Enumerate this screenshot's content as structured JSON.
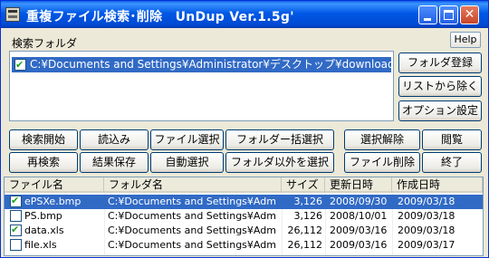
{
  "window": {
    "title": "重複ファイル検索･削除　UnDup Ver.1.5g'"
  },
  "help_label": "Help",
  "folder_section": {
    "label": "検索フォルダ",
    "items": [
      {
        "path": "C:¥Documents and Settings¥Administrator¥デスクトップ¥download",
        "checked": true,
        "selected": true
      }
    ]
  },
  "side_buttons": {
    "register": "フォルダ登録",
    "remove": "リストから除く",
    "options": "オプション設定"
  },
  "buttons": {
    "search_start": "検索開始",
    "load": "読込み",
    "file_select": "ファイル選択",
    "folder_bulk_select": "フォルダー括選択",
    "deselect": "選択解除",
    "browse": "閲覧",
    "research": "再検索",
    "save_results": "結果保存",
    "auto_select": "自動選択",
    "select_outside_folder": "フォルダ以外を選択",
    "delete_file": "ファイル削除",
    "exit": "終了"
  },
  "results": {
    "columns": [
      "ファイル名",
      "フォルダ名",
      "サイズ",
      "更新日時",
      "作成日時"
    ],
    "rows": [
      {
        "name": "ePSXe.bmp",
        "folder": "C:¥Documents and Settings¥Adm",
        "size": "3,126",
        "modified": "2008/09/30",
        "created": "2009/03/18",
        "checked": true,
        "selected": true
      },
      {
        "name": "PS.bmp",
        "folder": "C:¥Documents and Settings¥Adm",
        "size": "3,126",
        "modified": "2008/10/01",
        "created": "2009/03/18",
        "checked": false,
        "selected": false
      },
      {
        "name": "data.xls",
        "folder": "C:¥Documents and Settings¥Adm",
        "size": "26,112",
        "modified": "2009/03/16",
        "created": "2009/03/18",
        "checked": true,
        "selected": false
      },
      {
        "name": "file.xls",
        "folder": "C:¥Documents and Settings¥Adm",
        "size": "26,112",
        "modified": "2009/03/16",
        "created": "2009/03/17",
        "checked": false,
        "selected": false
      }
    ]
  },
  "colors": {
    "title_bar": "#0058e6",
    "selection": "#316ac5",
    "window_bg": "#ece9d8"
  }
}
